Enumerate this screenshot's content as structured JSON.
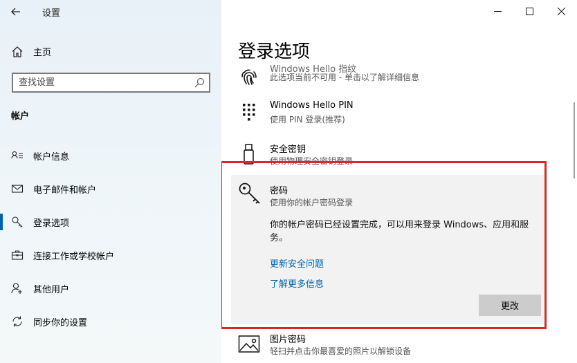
{
  "window": {
    "app_title": "设置",
    "back_icon": "back-arrow-icon",
    "controls": [
      "minimize-icon",
      "maximize-icon",
      "close-icon"
    ]
  },
  "sidebar": {
    "home_label": "主页",
    "search_placeholder": "查找设置",
    "section_heading": "帐户",
    "items": [
      {
        "label": "帐户信息",
        "icon": "account-info-icon"
      },
      {
        "label": "电子邮件和帐户",
        "icon": "mail-icon"
      },
      {
        "label": "登录选项",
        "icon": "key-icon",
        "active": true
      },
      {
        "label": "连接工作或学校帐户",
        "icon": "briefcase-icon"
      },
      {
        "label": "其他用户",
        "icon": "person-add-icon"
      },
      {
        "label": "同步你的设置",
        "icon": "sync-icon"
      }
    ]
  },
  "main": {
    "page_title": "登录选项",
    "options": [
      {
        "title": "Windows Hello 指纹",
        "desc": "此选项当前不可用 - 单击以了解详细信息",
        "icon": "fingerprint-icon"
      },
      {
        "title": "Windows Hello PIN",
        "desc": "使用 PIN 登录(推荐)",
        "icon": "pin-keypad-icon"
      },
      {
        "title": "安全密钥",
        "desc": "使用物理安全密钥登录",
        "icon": "usb-key-icon"
      },
      {
        "title": "图片密码",
        "desc": "轻扫并点击你最喜爱的照片以解锁设备",
        "icon": "picture-icon"
      }
    ],
    "password": {
      "title": "密码",
      "desc": "使用你的帐户密码登录",
      "info": "你的帐户密码已经设置完成，可以用来登录 Windows、应用和服务。",
      "link_update": "更新安全问题",
      "link_learn": "了解更多信息",
      "change_button": "更改"
    }
  },
  "colors": {
    "accent": "#0063b1",
    "highlight": "#d42a2a",
    "panel_bg": "#f2f2f2",
    "button_bg": "#cccccc"
  }
}
